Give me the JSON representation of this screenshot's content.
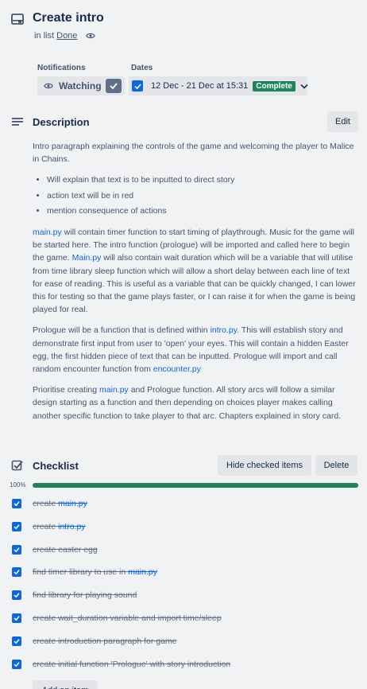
{
  "card": {
    "title": "Create intro",
    "in_list_prefix": "in list",
    "list_name": "Done"
  },
  "notifications": {
    "label": "Notifications",
    "watch_label": "Watching"
  },
  "dates": {
    "label": "Dates",
    "range": "12 Dec - 21 Dec at 15:31",
    "status": "Complete"
  },
  "description": {
    "title": "Description",
    "edit_label": "Edit",
    "intro": "Intro paragraph explaining the controls of the game and welcoming the player to Malice in Chains.",
    "bullets": [
      "Will explain that text is to be inputted to direct story",
      "action text will be in red",
      "mention consequence of actions"
    ],
    "p2_link1": "main.py",
    "p2_text1": " will contain timer function to start timing of playthrough. Music for the game will be started here. The intro function (prologue) will be imported and called here to begin the game. ",
    "p2_link2": "Main.py",
    "p2_text2": " will also contain wait duration which will be a variable that will utilise from time library sleep function which will allow a short delay between each line of text for ease of reading. This is useful as a variable that can be quickly changed, I can lower this for testing so that the game plays faster, or I can raise it for when the game is being played for real.",
    "p3_text1": "Prologue will be a function that is defined within ",
    "p3_link1": "intro.py",
    "p3_text2": ". This will establish story and demonstrate first input from user to 'open' your eyes. This will contain a hidden Easter egg, the first hidden piece of text that can be inputted. Prologue will import and call random encounter function from ",
    "p3_link2": "encounter.py",
    "p4_text1": "Prioritise creating ",
    "p4_link1": "main.py",
    "p4_text2": " and Prologue function. All story arcs will follow a similar design starting as a function and then depending on choices player makes calling another specific function to take player to that arc. Chapters explained in story card."
  },
  "checklist": {
    "title": "Checklist",
    "hide_label": "Hide checked items",
    "delete_label": "Delete",
    "progress_text": "100%",
    "progress_fraction": 1.0,
    "add_label": "Add an item",
    "items": [
      {
        "pre": "create ",
        "link": "main.py",
        "post": ""
      },
      {
        "pre": "create ",
        "link": "intro.py",
        "post": ""
      },
      {
        "pre": "create easter egg",
        "link": "",
        "post": ""
      },
      {
        "pre": "find timer library to use in ",
        "link": "main.py",
        "post": ""
      },
      {
        "pre": "find library for playing sound",
        "link": "",
        "post": ""
      },
      {
        "pre": "create wait_duration variable and import time/sleep",
        "link": "",
        "post": ""
      },
      {
        "pre": "create introduction paragraph for game",
        "link": "",
        "post": ""
      },
      {
        "pre": "create initial function 'Prologue' with story introduction",
        "link": "",
        "post": ""
      }
    ]
  },
  "colors": {
    "accent": "#0c66e4",
    "complete": "#1f845a",
    "background": "#f1f2f4"
  },
  "icons": [
    "card-icon",
    "eye-icon",
    "check-icon",
    "chevron-down-icon",
    "description-icon",
    "checklist-icon"
  ]
}
